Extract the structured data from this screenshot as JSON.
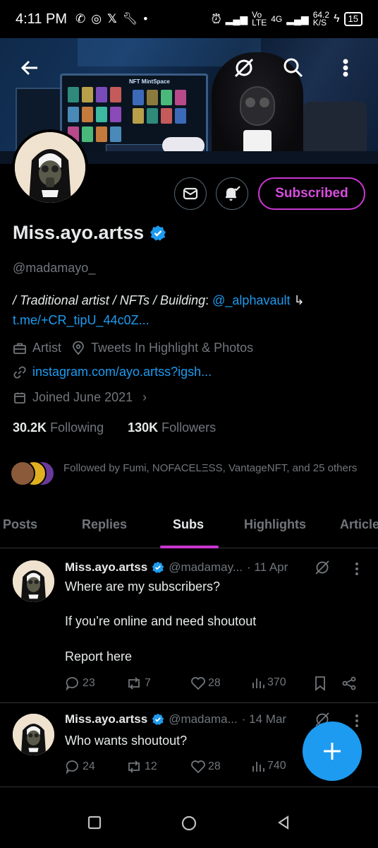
{
  "status_bar": {
    "time": "4:11 PM",
    "network_speed": "64.2",
    "network_speed_unit": "K/S",
    "network_label_1": "Vo",
    "network_label_2": "LTE",
    "network_label_3": "4G",
    "battery": "15"
  },
  "banner": {
    "monitor_label": "NFT MintSpace"
  },
  "profile": {
    "name": "Miss.ayo.artss",
    "handle": "@madamayo_",
    "subscribe_label": "Subscribed",
    "bio_part1": "/ Traditional artist / NFTs / Building",
    "bio_colon": ":",
    "bio_mention": "@_alphavault",
    "bio_link": "t.me/+CR_tipU_44c0Z...",
    "category": "Artist",
    "location": "Tweets In Highlight & Photos",
    "website": "instagram.com/ayo.artss?igsh...",
    "joined": "Joined June 2021",
    "following_count": "30.2K",
    "following_label": "Following",
    "followers_count": "130K",
    "followers_label": "Followers",
    "followed_by": "Followed by Fumi, NOFACELΞSS, VantageNFT, and 25 others"
  },
  "tabs": [
    {
      "label": "Posts"
    },
    {
      "label": "Replies"
    },
    {
      "label": "Subs"
    },
    {
      "label": "Highlights"
    },
    {
      "label": "Article"
    }
  ],
  "posts": [
    {
      "name": "Miss.ayo.artss",
      "handle": "@madamay...",
      "date": "· 11 Apr",
      "line1": "Where are my subscribers?",
      "line2": "If you’re online and need shoutout",
      "line3": "Report here",
      "replies": "23",
      "reposts": "7",
      "likes": "28",
      "views": "370"
    },
    {
      "name": "Miss.ayo.artss",
      "handle": "@madama...",
      "date": "· 14 Mar",
      "line1": "Who wants shoutout?",
      "replies": "24",
      "reposts": "12",
      "likes": "28",
      "views": "740"
    }
  ],
  "colors": {
    "accent": "#c936cf",
    "link": "#1d9bf0",
    "verified": "#1d9bf0"
  }
}
